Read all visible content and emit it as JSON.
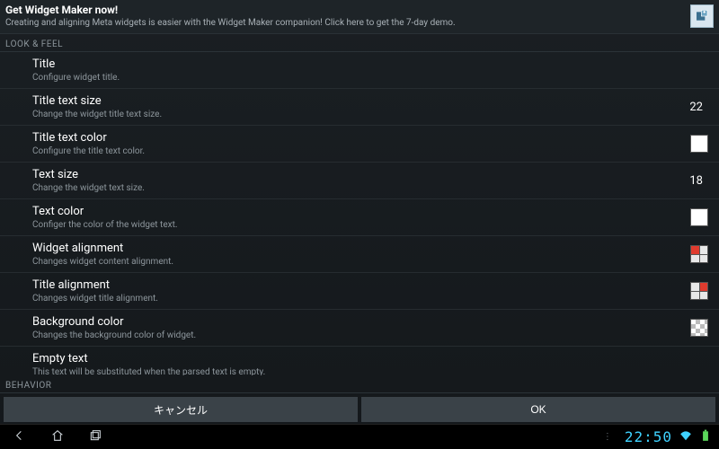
{
  "banner": {
    "title": "Get Widget Maker now!",
    "subtitle": "Creating and aligning Meta widgets is easier with the Widget Maker companion! Click here to get the 7-day demo."
  },
  "sections": {
    "look_feel": "LOOK & FEEL",
    "behavior": "BEHAVIOR"
  },
  "rows": {
    "title": {
      "title": "Title",
      "sub": "Configure widget title."
    },
    "title_size": {
      "title": "Title text size",
      "sub": "Change the widget title text size.",
      "value": "22"
    },
    "title_color": {
      "title": "Title text color",
      "sub": "Configure the title text color.",
      "color": "#ffffff"
    },
    "text_size": {
      "title": "Text size",
      "sub": "Change the widget text size.",
      "value": "18"
    },
    "text_color": {
      "title": "Text color",
      "sub": "Configer the color of the widget text.",
      "color": "#ffffff"
    },
    "widget_align": {
      "title": "Widget alignment",
      "sub": "Changes widget content alignment.",
      "highlight_cell": 0
    },
    "title_align": {
      "title": "Title alignment",
      "sub": "Changes widget title alignment.",
      "highlight_cell": 1
    },
    "bg_color": {
      "title": "Background color",
      "sub": "Changes the background color of widget.",
      "color": "#ffffff",
      "alpha_checker": true
    },
    "empty_text": {
      "title": "Empty text",
      "sub": "This text will be substituted when the parsed text is empty."
    }
  },
  "buttons": {
    "cancel": "キャンセル",
    "ok": "OK"
  },
  "status": {
    "clock": "22:50"
  }
}
